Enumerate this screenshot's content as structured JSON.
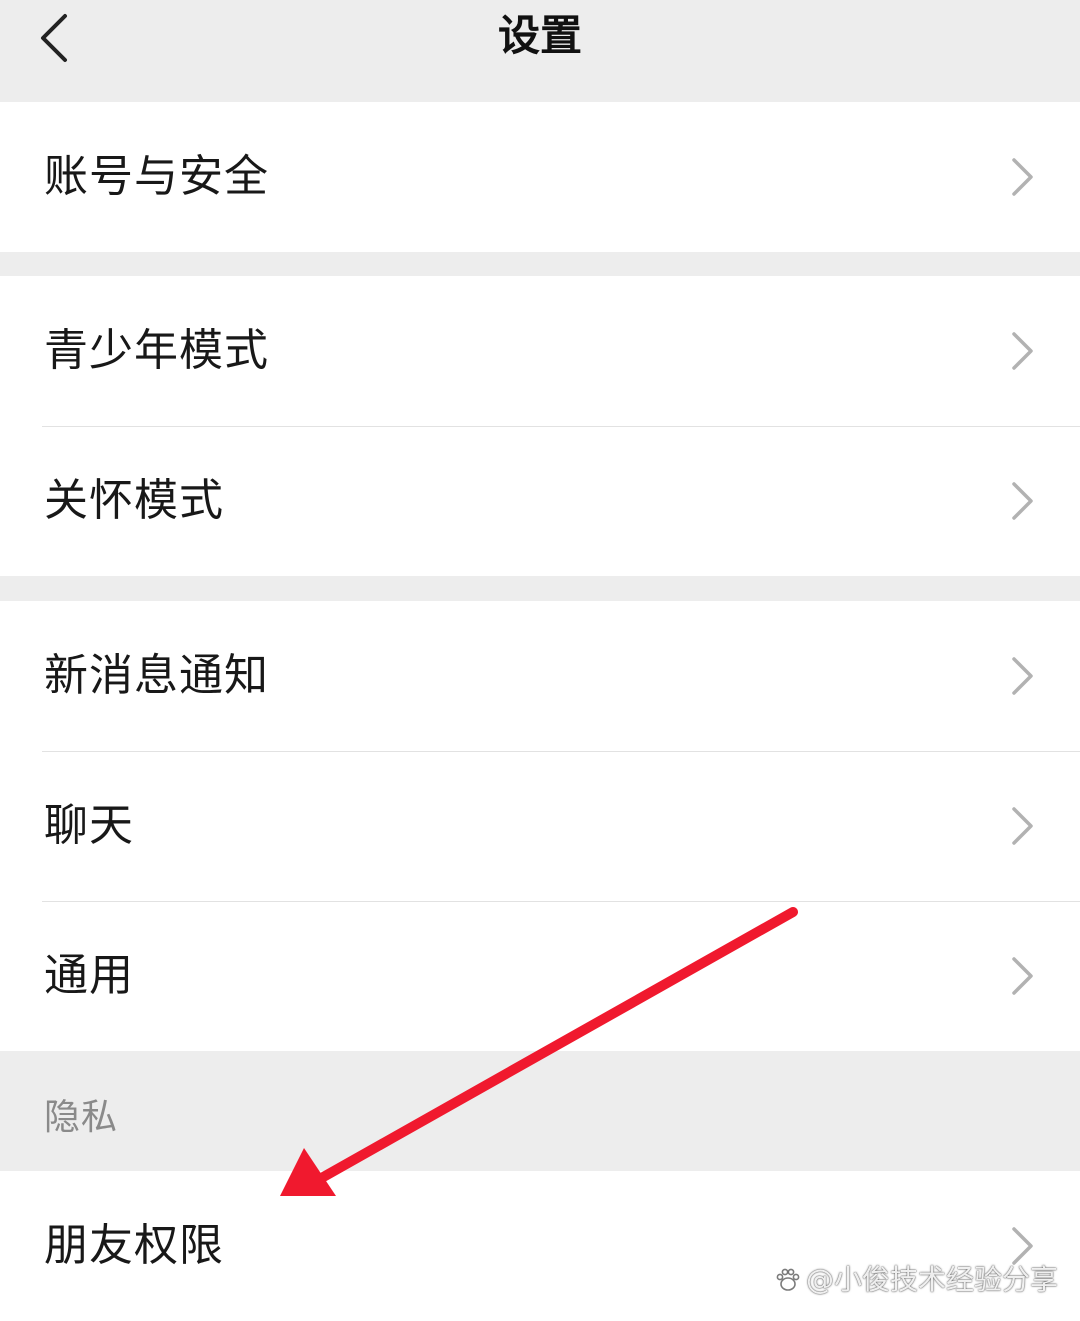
{
  "header": {
    "title": "设置",
    "back_icon": "chevron-left-icon"
  },
  "groups": [
    {
      "items": [
        {
          "label": "账号与安全"
        }
      ]
    },
    {
      "items": [
        {
          "label": "青少年模式"
        },
        {
          "label": "关怀模式"
        }
      ]
    },
    {
      "items": [
        {
          "label": "新消息通知"
        },
        {
          "label": "聊天"
        },
        {
          "label": "通用"
        }
      ]
    }
  ],
  "privacy_section": {
    "header": "隐私",
    "items": [
      {
        "label": "朋友权限"
      }
    ]
  },
  "annotation": {
    "arrow_color": "#f0192e",
    "pointing_to": "朋友权限"
  },
  "watermark": {
    "text": "@小俊技术经验分享"
  },
  "colors": {
    "background": "#ededed",
    "row_background": "#ffffff",
    "chevron": "#b2b2b2"
  }
}
